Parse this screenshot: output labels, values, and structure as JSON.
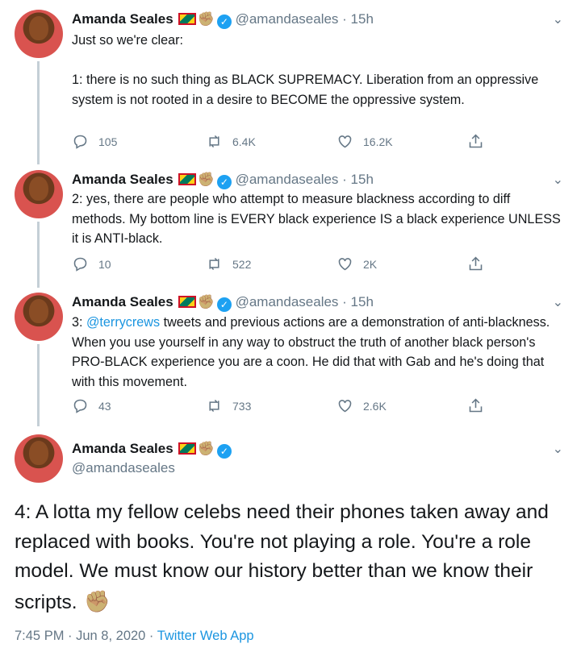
{
  "author": {
    "name": "Amanda Seales",
    "handle": "@amandaseales",
    "flag": "grenada-flag",
    "emoji": "✊",
    "verified": "✓"
  },
  "tweets": [
    {
      "time": "· 15h",
      "text": "Just so we're clear:\n\n1: there is no such thing as BLACK SUPREMACY. Liberation from an oppressive system is not rooted in a desire to BECOME the oppressive system.",
      "replies": "105",
      "retweets": "6.4K",
      "likes": "16.2K"
    },
    {
      "time": "· 15h",
      "text": "2: yes, there are people who attempt to measure blackness according to diff methods. My bottom line is EVERY black experience IS a black experience UNLESS it is ANTI-black.",
      "replies": "10",
      "retweets": "522",
      "likes": "2K"
    },
    {
      "time": "· 15h",
      "mention": "@terrycrews",
      "text": " tweets and previous actions are a demonstration of anti-blackness. When you use yourself in any way to obstruct the truth of another black person's PRO-BLACK experience you are a coon. He did that with Gab and he's doing that with this movement.",
      "prefix": "3: ",
      "replies": "43",
      "retweets": "733",
      "likes": "2.6K"
    }
  ],
  "main_tweet": {
    "text": "4: A lotta my fellow celebs need their phones taken away and replaced with books. You're not playing a role. You're a role model. We must know our history better than we know their scripts. ",
    "emoji": "✊",
    "timestamp": "7:45 PM · Jun 8, 2020 · ",
    "app": "Twitter Web App"
  },
  "icons": {
    "reply": "reply-icon",
    "retweet": "retweet-icon",
    "like": "heart-icon",
    "share": "share-icon",
    "menu": "chevron-down-icon"
  },
  "colors": {
    "link": "#1b95e0",
    "verified": "#1da1f2",
    "muted": "#657786"
  }
}
